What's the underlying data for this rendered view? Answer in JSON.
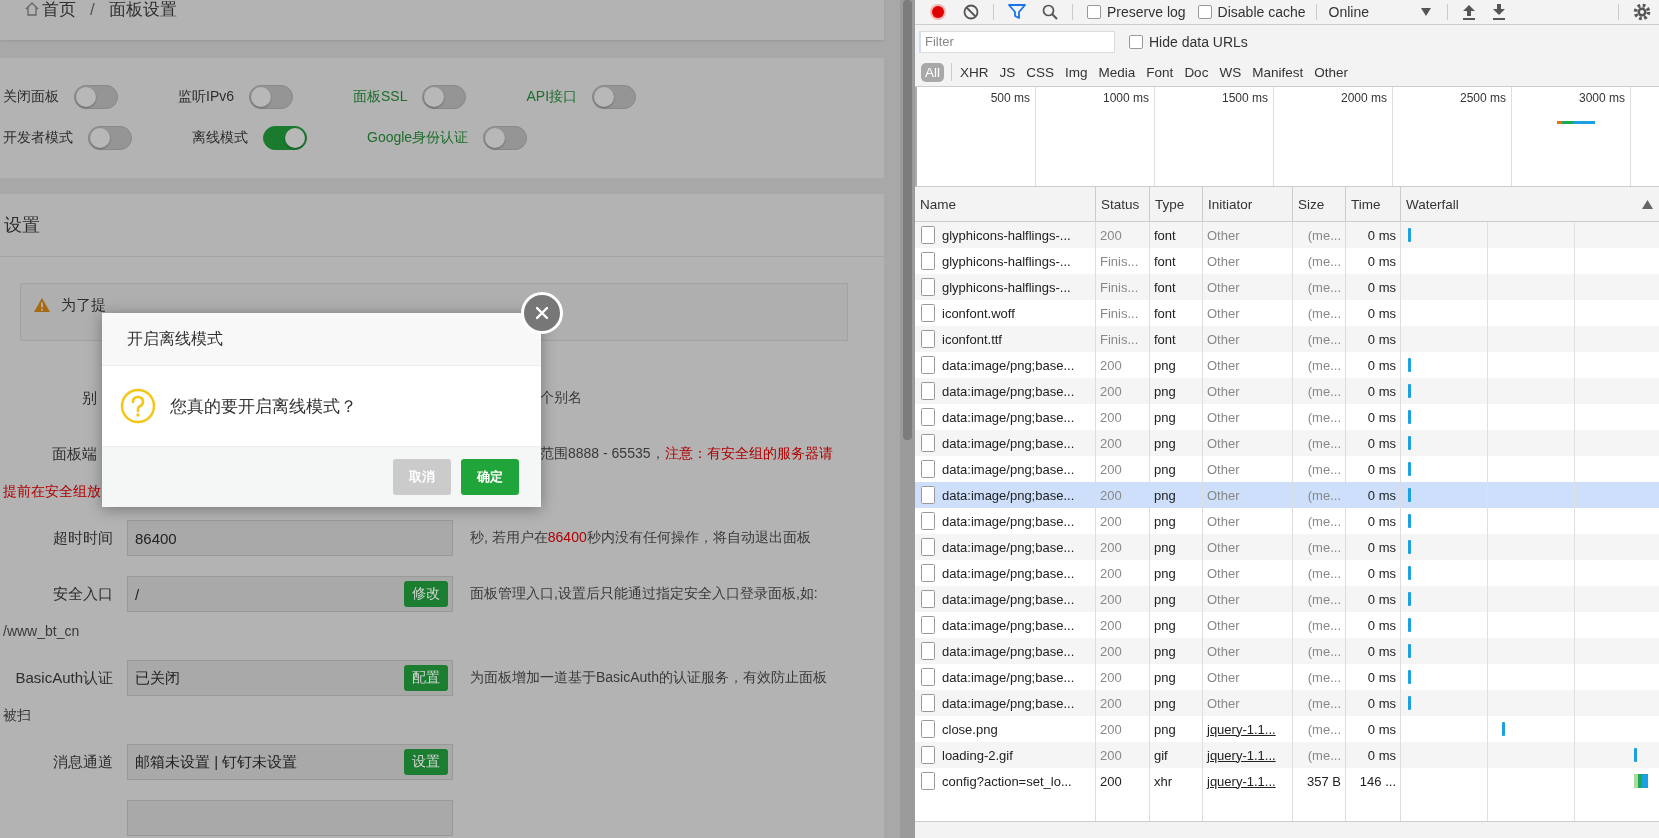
{
  "breadcrumb": {
    "home": "首页",
    "separator": "/",
    "current": "面板设置"
  },
  "toggle_rows": [
    {
      "items": [
        {
          "label": "关闭面板",
          "link": false,
          "on": false
        },
        {
          "label": "监听IPv6",
          "link": false,
          "on": false
        },
        {
          "label": "面板SSL",
          "link": true,
          "on": false
        },
        {
          "label": "API接口",
          "link": true,
          "on": false
        }
      ]
    },
    {
      "items": [
        {
          "label": "开发者模式",
          "link": false,
          "on": false
        },
        {
          "label": "离线模式",
          "link": false,
          "on": true
        },
        {
          "label": "Google身份认证",
          "link": true,
          "on": false
        }
      ]
    }
  ],
  "settings": {
    "title": "设置",
    "warning": "为了提",
    "rows": [
      {
        "kind": "obscured",
        "label": "别",
        "description": [
          {
            "text": "个别名",
            "emphasis": false
          }
        ]
      },
      {
        "kind": "obscured",
        "label": "面板端",
        "description": [
          {
            "text": "范围8888 - 65535，",
            "emphasis": false
          },
          {
            "text": "注意：有安全组的服务器请",
            "emphasis": true
          }
        ],
        "continuation": {
          "text": "提前在安全组放",
          "emphasis": true
        }
      },
      {
        "kind": "field",
        "label": "超时时间",
        "value": "86400",
        "description": [
          {
            "text": "秒, 若用户在",
            "emphasis": false
          },
          {
            "text": "86400",
            "emphasis": true
          },
          {
            "text": "秒内没有任何操作，将自动退出面板",
            "emphasis": false
          }
        ]
      },
      {
        "kind": "field",
        "label": "安全入口",
        "value": "/",
        "button": "修改",
        "description": [
          {
            "text": "面板管理入口,设置后只能通过指定安全入口登录面板,如:",
            "emphasis": false
          }
        ],
        "continuation": {
          "text": "/www_bt_cn",
          "emphasis": false
        }
      },
      {
        "kind": "field",
        "label": "BasicAuth认证",
        "value": "已关闭",
        "button": "配置",
        "description": [
          {
            "text": "为面板增加一道基于BasicAuth的认证服务，有效防止面板",
            "emphasis": false
          }
        ],
        "continuation": {
          "text": "被扫",
          "emphasis": false
        }
      },
      {
        "kind": "field",
        "label": "消息通道",
        "value": "邮箱未设置 | 钉钉未设置",
        "button": "设置"
      },
      {
        "kind": "field"
      }
    ]
  },
  "dialog": {
    "title": "开启离线模式",
    "message": "您真的要开启离线模式？",
    "buttons": [
      {
        "label": "取消",
        "kind": "cancel"
      },
      {
        "label": "确定",
        "kind": "confirm"
      }
    ]
  },
  "devtools": {
    "recording": true,
    "filter_active": true,
    "checkboxes": [
      {
        "label": "Preserve log",
        "checked": false
      },
      {
        "label": "Disable cache",
        "checked": false
      }
    ],
    "throttle": "Online",
    "filter": {
      "placeholder": "Filter",
      "hide_data_urls": {
        "label": "Hide data URLs",
        "checked": false
      }
    },
    "types": [
      {
        "label": "All",
        "selected": true
      },
      {
        "label": "XHR",
        "selected": false
      },
      {
        "label": "JS",
        "selected": false
      },
      {
        "label": "CSS",
        "selected": false
      },
      {
        "label": "Img",
        "selected": false
      },
      {
        "label": "Media",
        "selected": false
      },
      {
        "label": "Font",
        "selected": false
      },
      {
        "label": "Doc",
        "selected": false
      },
      {
        "label": "WS",
        "selected": false
      },
      {
        "label": "Manifest",
        "selected": false
      },
      {
        "label": "Other",
        "selected": false
      }
    ],
    "overview_ticks": [
      "500 ms",
      "1000 ms",
      "1500 ms",
      "2000 ms",
      "2500 ms",
      "3000 ms"
    ],
    "columns": [
      "Name",
      "Status",
      "Type",
      "Initiator",
      "Size",
      "Time",
      "Waterfall"
    ],
    "rows": [
      {
        "name": "glyphicons-halflings-...",
        "status": "200",
        "type": "font",
        "initiator": "Other",
        "initiator_link": false,
        "size": "(me...",
        "time": "0 ms",
        "cached": true,
        "timing": {
          "kind": "start"
        },
        "selected": false
      },
      {
        "name": "glyphicons-halflings-...",
        "status": "Finis...",
        "type": "font",
        "initiator": "Other",
        "initiator_link": false,
        "size": "(me...",
        "time": "0 ms",
        "cached": true,
        "selected": false
      },
      {
        "name": "glyphicons-halflings-...",
        "status": "Finis...",
        "type": "font",
        "initiator": "Other",
        "initiator_link": false,
        "size": "(me...",
        "time": "0 ms",
        "cached": true,
        "selected": false
      },
      {
        "name": "iconfont.woff",
        "status": "Finis...",
        "type": "font",
        "initiator": "Other",
        "initiator_link": false,
        "size": "(me...",
        "time": "0 ms",
        "cached": true,
        "selected": false
      },
      {
        "name": "iconfont.ttf",
        "status": "Finis...",
        "type": "font",
        "initiator": "Other",
        "initiator_link": false,
        "size": "(me...",
        "time": "0 ms",
        "cached": true,
        "selected": false
      },
      {
        "name": "data:image/png;base...",
        "status": "200",
        "type": "png",
        "initiator": "Other",
        "initiator_link": false,
        "size": "(me...",
        "time": "0 ms",
        "cached": true,
        "timing": {
          "kind": "start"
        },
        "selected": false
      },
      {
        "name": "data:image/png;base...",
        "status": "200",
        "type": "png",
        "initiator": "Other",
        "initiator_link": false,
        "size": "(me...",
        "time": "0 ms",
        "cached": true,
        "timing": {
          "kind": "start"
        },
        "selected": false
      },
      {
        "name": "data:image/png;base...",
        "status": "200",
        "type": "png",
        "initiator": "Other",
        "initiator_link": false,
        "size": "(me...",
        "time": "0 ms",
        "cached": true,
        "timing": {
          "kind": "start"
        },
        "selected": false
      },
      {
        "name": "data:image/png;base...",
        "status": "200",
        "type": "png",
        "initiator": "Other",
        "initiator_link": false,
        "size": "(me...",
        "time": "0 ms",
        "cached": true,
        "timing": {
          "kind": "start"
        },
        "selected": false
      },
      {
        "name": "data:image/png;base...",
        "status": "200",
        "type": "png",
        "initiator": "Other",
        "initiator_link": false,
        "size": "(me...",
        "time": "0 ms",
        "cached": true,
        "timing": {
          "kind": "start"
        },
        "selected": false
      },
      {
        "name": "data:image/png;base...",
        "status": "200",
        "type": "png",
        "initiator": "Other",
        "initiator_link": false,
        "size": "(me...",
        "time": "0 ms",
        "cached": true,
        "timing": {
          "kind": "start"
        },
        "selected": true
      },
      {
        "name": "data:image/png;base...",
        "status": "200",
        "type": "png",
        "initiator": "Other",
        "initiator_link": false,
        "size": "(me...",
        "time": "0 ms",
        "cached": true,
        "timing": {
          "kind": "start"
        },
        "selected": false
      },
      {
        "name": "data:image/png;base...",
        "status": "200",
        "type": "png",
        "initiator": "Other",
        "initiator_link": false,
        "size": "(me...",
        "time": "0 ms",
        "cached": true,
        "timing": {
          "kind": "start"
        },
        "selected": false
      },
      {
        "name": "data:image/png;base...",
        "status": "200",
        "type": "png",
        "initiator": "Other",
        "initiator_link": false,
        "size": "(me...",
        "time": "0 ms",
        "cached": true,
        "timing": {
          "kind": "start"
        },
        "selected": false
      },
      {
        "name": "data:image/png;base...",
        "status": "200",
        "type": "png",
        "initiator": "Other",
        "initiator_link": false,
        "size": "(me...",
        "time": "0 ms",
        "cached": true,
        "timing": {
          "kind": "start"
        },
        "selected": false
      },
      {
        "name": "data:image/png;base...",
        "status": "200",
        "type": "png",
        "initiator": "Other",
        "initiator_link": false,
        "size": "(me...",
        "time": "0 ms",
        "cached": true,
        "timing": {
          "kind": "start"
        },
        "selected": false
      },
      {
        "name": "data:image/png;base...",
        "status": "200",
        "type": "png",
        "initiator": "Other",
        "initiator_link": false,
        "size": "(me...",
        "time": "0 ms",
        "cached": true,
        "timing": {
          "kind": "start"
        },
        "selected": false
      },
      {
        "name": "data:image/png;base...",
        "status": "200",
        "type": "png",
        "initiator": "Other",
        "initiator_link": false,
        "size": "(me...",
        "time": "0 ms",
        "cached": true,
        "timing": {
          "kind": "start"
        },
        "selected": false
      },
      {
        "name": "data:image/png;base...",
        "status": "200",
        "type": "png",
        "initiator": "Other",
        "initiator_link": false,
        "size": "(me...",
        "time": "0 ms",
        "cached": true,
        "timing": {
          "kind": "start"
        },
        "selected": false
      },
      {
        "name": "close.png",
        "status": "200",
        "type": "png",
        "initiator": "jquery-1.1...",
        "initiator_link": true,
        "size": "(me...",
        "time": "0 ms",
        "cached": true,
        "timing": {
          "kind": "middle"
        },
        "selected": false
      },
      {
        "name": "loading-2.gif",
        "status": "200",
        "type": "gif",
        "initiator": "jquery-1.1...",
        "initiator_link": true,
        "size": "(me...",
        "time": "0 ms",
        "cached": true,
        "timing": {
          "kind": "end"
        },
        "selected": false
      },
      {
        "name": "config?action=set_lo...",
        "status": "200",
        "type": "xhr",
        "initiator": "jquery-1.1...",
        "initiator_link": true,
        "size": "357 B",
        "time": "146 ...",
        "cached": false,
        "timing": {
          "kind": "end-long"
        },
        "selected": false
      }
    ]
  }
}
